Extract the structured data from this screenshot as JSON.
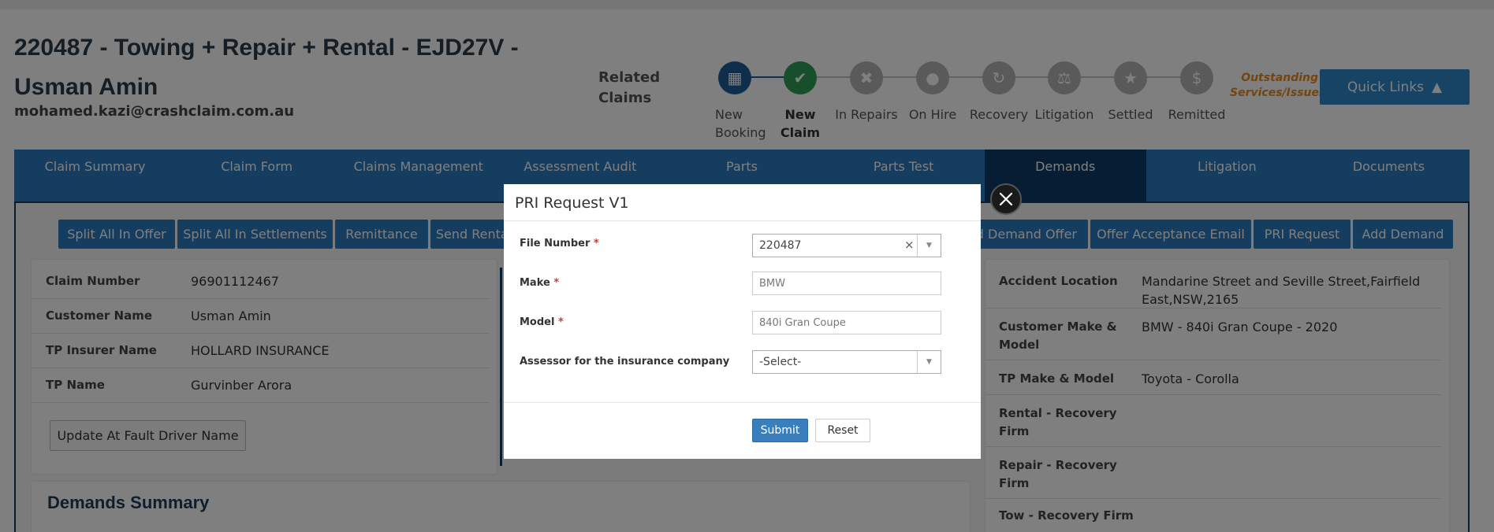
{
  "header": {
    "title": "220487 - Towing + Repair + Rental - EJD27V - Usman Amin",
    "email": "mohamed.kazi@crashclaim.com.au",
    "related_claims": "Related Claims",
    "outstanding": "Outstanding Services/Issues",
    "quick_links": "Quick Links"
  },
  "steps": [
    {
      "label": "New Booking",
      "icon": "booking-icon"
    },
    {
      "label": "New Claim",
      "icon": "claim-icon"
    },
    {
      "label": "In Repairs",
      "icon": "wrench-icon"
    },
    {
      "label": "On Hire",
      "icon": "car-icon"
    },
    {
      "label": "Recovery",
      "icon": "refresh-icon"
    },
    {
      "label": "Litigation",
      "icon": "gavel-icon"
    },
    {
      "label": "Settled",
      "icon": "handshake-icon"
    },
    {
      "label": "Remitted",
      "icon": "money-icon"
    }
  ],
  "tabs": [
    "Claim Summary",
    "Claim Form",
    "Claims Management",
    "Assessment Audit",
    "Parts",
    "Parts Test",
    "Demands",
    "Litigation",
    "Documents"
  ],
  "actions": [
    "Split All In Offer",
    "Split All In Settlements",
    "Remittance",
    "Send Rental",
    "d Demand Offer",
    "Offer Acceptance Email",
    "PRI Request",
    "Add Demand"
  ],
  "left_details": [
    {
      "key": "Claim Number",
      "value": "96901112467"
    },
    {
      "key": "Customer Name",
      "value": "Usman Amin"
    },
    {
      "key": "TP Insurer Name",
      "value": "HOLLARD INSURANCE"
    },
    {
      "key": "TP Name",
      "value": "Gurvinber Arora"
    }
  ],
  "update_button": "Update At Fault Driver Name",
  "demands_summary": "Demands Summary",
  "right_details": [
    {
      "key": "Accident Location",
      "value": "Mandarine Street and Seville Street,Fairfield East,NSW,2165"
    },
    {
      "key": "Customer Make & Model",
      "value": "BMW - 840i Gran Coupe - 2020"
    },
    {
      "key": "TP Make & Model",
      "value": "Toyota - Corolla"
    },
    {
      "key": "Rental - Recovery Firm",
      "value": ""
    },
    {
      "key": "Repair - Recovery Firm",
      "value": ""
    },
    {
      "key": "Tow - Recovery Firm",
      "value": ""
    }
  ],
  "modal": {
    "title": "PRI Request V1",
    "fields": {
      "file_number": {
        "label": "File Number",
        "value": "220487"
      },
      "make": {
        "label": "Make",
        "value": "BMW"
      },
      "model": {
        "label": "Model",
        "value": "840i Gran Coupe"
      },
      "assessor": {
        "label": "Assessor for the insurance company",
        "value": "-Select-"
      }
    },
    "submit": "Submit",
    "reset": "Reset"
  },
  "colors": {
    "primary": "#2a7bbf",
    "active_tab": "#0d3a66",
    "claim_step": "#2f9e5a",
    "warning": "#e58a22"
  }
}
